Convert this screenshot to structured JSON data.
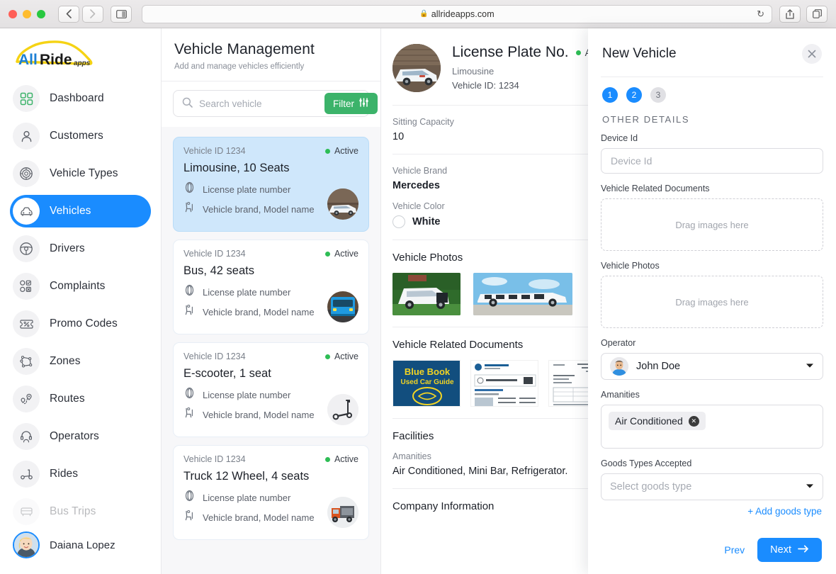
{
  "browser": {
    "url": "allrideapps.com",
    "lock_icon": "lock-icon",
    "back_icon": "chevron-left-icon",
    "forward_icon": "chevron-right-icon",
    "sidebar_icon": "sidebar-toggle-icon",
    "reload_icon": "reload-icon",
    "share_icon": "share-icon",
    "tabs_icon": "tabs-icon"
  },
  "brand": {
    "name": "AllRide",
    "suffix": "apps"
  },
  "sidebar": {
    "items": [
      {
        "label": "Dashboard",
        "icon": "grid-icon",
        "active": false,
        "faded": false
      },
      {
        "label": "Customers",
        "icon": "user-icon",
        "active": false,
        "faded": false
      },
      {
        "label": "Vehicle Types",
        "icon": "wheel-icon",
        "active": false,
        "faded": false
      },
      {
        "label": "Vehicles",
        "icon": "car-icon",
        "active": true,
        "faded": false
      },
      {
        "label": "Drivers",
        "icon": "steering-wheel-icon",
        "active": false,
        "faded": false
      },
      {
        "label": "Complaints",
        "icon": "complaint-icon",
        "active": false,
        "faded": false
      },
      {
        "label": "Promo Codes",
        "icon": "ticket-percent-icon",
        "active": false,
        "faded": false
      },
      {
        "label": "Zones",
        "icon": "polygon-icon",
        "active": false,
        "faded": false
      },
      {
        "label": "Routes",
        "icon": "route-pin-icon",
        "active": false,
        "faded": false
      },
      {
        "label": "Operators",
        "icon": "headset-icon",
        "active": false,
        "faded": false
      },
      {
        "label": "Rides",
        "icon": "scooter-icon",
        "active": false,
        "faded": false
      },
      {
        "label": "Bus Trips",
        "icon": "bus-icon",
        "active": false,
        "faded": true
      }
    ],
    "profile": {
      "name": "Daiana Lopez",
      "avatar": "user-avatar"
    }
  },
  "page": {
    "title": "Vehicle Management",
    "subtitle": "Add and manage vehicles efficiently"
  },
  "search": {
    "placeholder": "Search vehicle",
    "value": "",
    "icon": "search-icon",
    "filter_label": "Filter",
    "filter_icon": "sliders-icon",
    "filter_color": "#3cb36a"
  },
  "vehicle_list": [
    {
      "id_label": "Vehicle ID 1234",
      "status": "Active",
      "name": "Limousine, 10 Seats",
      "plate_label": "License plate number",
      "brand_label": "Vehicle brand, Model name",
      "plate_icon": "tire-icon",
      "brand_icon": "seat-icon",
      "thumb": "limousine-photo",
      "selected": true
    },
    {
      "id_label": "Vehicle ID 1234",
      "status": "Active",
      "name": "Bus, 42 seats",
      "plate_label": "License plate number",
      "brand_label": "Vehicle brand, Model name",
      "plate_icon": "tire-icon",
      "brand_icon": "seat-icon",
      "thumb": "bus-photo",
      "selected": false
    },
    {
      "id_label": "Vehicle ID 1234",
      "status": "Active",
      "name": "E-scooter, 1 seat",
      "plate_label": "License plate number",
      "brand_label": "Vehicle brand, Model name",
      "plate_icon": "tire-icon",
      "brand_icon": "seat-icon",
      "thumb": "scooter-photo",
      "selected": false
    },
    {
      "id_label": "Vehicle ID 1234",
      "status": "Active",
      "name": "Truck 12 Wheel, 4 seats",
      "plate_label": "License plate number",
      "brand_label": "Vehicle brand, Model name",
      "plate_icon": "tire-icon",
      "brand_icon": "seat-icon",
      "thumb": "truck-photo",
      "selected": false
    }
  ],
  "detail": {
    "title": "License Plate No.",
    "status": "Active",
    "type": "Limousine",
    "vehicle_id": "Vehicle ID: 1234",
    "avatar": "limousine-photo",
    "sitting_capacity_label": "Sitting Capacity",
    "sitting_capacity_value": "10",
    "brand_label": "Vehicle Brand",
    "brand_value": "Mercedes",
    "color_label": "Vehicle Color",
    "color_value": "White",
    "photos_title": "Vehicle Photos",
    "photos": [
      "limousine-front-photo",
      "limousine-side-photo"
    ],
    "documents_title": "Vehicle Related Documents",
    "documents": [
      "blue-book-used-car-guide",
      "kelley-blue-book-report",
      "registration-document"
    ],
    "facilities_title": "Facilities",
    "amenities_label": "Amanities",
    "amenities_value": "Air Conditioned, Mini Bar, Refrigerator.",
    "company_title": "Company Information"
  },
  "new_vehicle": {
    "title": "New Vehicle",
    "close_icon": "close-icon",
    "steps": [
      {
        "label": "1",
        "state": "active"
      },
      {
        "label": "2",
        "state": "active"
      },
      {
        "label": "3",
        "state": "inactive"
      }
    ],
    "section_title": "OTHER DETAILS",
    "device_id": {
      "label": "Device Id",
      "placeholder": "Device Id",
      "value": ""
    },
    "documents": {
      "label": "Vehicle Related Documents",
      "dropzone_text": "Drag images here"
    },
    "photos": {
      "label": "Vehicle Photos",
      "dropzone_text": "Drag images here"
    },
    "operator": {
      "label": "Operator",
      "value": "John Doe",
      "avatar": "operator-avatar",
      "caret_icon": "caret-down-icon"
    },
    "amenities": {
      "label": "Amanities",
      "chips": [
        {
          "label": "Air Conditioned",
          "remove_icon": "close-circle-icon"
        }
      ]
    },
    "goods": {
      "label": "Goods Types Accepted",
      "placeholder": "Select goods type",
      "caret_icon": "caret-down-icon"
    },
    "add_goods_link": "+ Add goods type",
    "prev_label": "Prev",
    "next_label": "Next",
    "next_icon": "arrow-right-icon",
    "accent_color": "#1a8cff"
  }
}
